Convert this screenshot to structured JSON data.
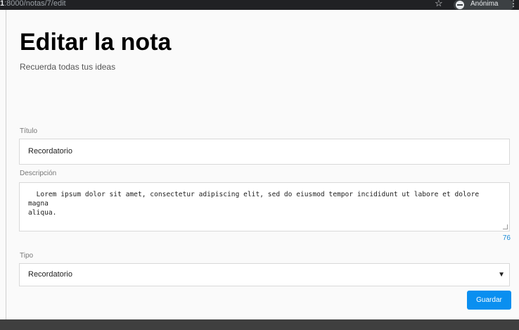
{
  "browser": {
    "url_prefix": "1",
    "url_rest": ":8000/notas/7/edit",
    "profile": "Anónima"
  },
  "page": {
    "title": "Editar la nota",
    "subtitle": "Recuerda todas tus ideas"
  },
  "form": {
    "title_label": "Título",
    "title_value": "Recordatorio",
    "description_label": "Descripción",
    "description_value": "  Lorem ipsum dolor sit amet, consectetur adipiscing elit, sed do eiusmod tempor incididunt ut labore et dolore magna\naliqua.",
    "char_count": "76",
    "type_label": "Tipo",
    "type_value": "Recordatorio",
    "save_label": "Guardar"
  },
  "colors": {
    "accent": "#0a8ff0",
    "counter": "#1a8ad6"
  }
}
